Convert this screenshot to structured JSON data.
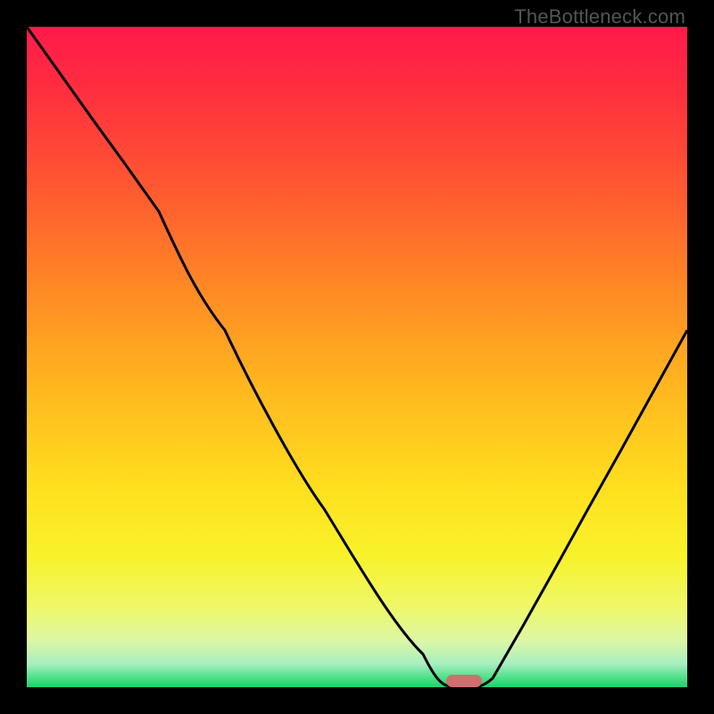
{
  "watermark": "TheBottleneck.com",
  "colors": {
    "bg_black": "#000000",
    "marker": "#cf6f6f",
    "curve_stroke": "#000000",
    "gradient_stops": [
      {
        "offset": 0.0,
        "color": "#ff1a4a"
      },
      {
        "offset": 0.1,
        "color": "#ff2f3f"
      },
      {
        "offset": 0.25,
        "color": "#ff5a30"
      },
      {
        "offset": 0.4,
        "color": "#ff8a25"
      },
      {
        "offset": 0.55,
        "color": "#ffb81f"
      },
      {
        "offset": 0.7,
        "color": "#ffe01f"
      },
      {
        "offset": 0.8,
        "color": "#f8f22a"
      },
      {
        "offset": 0.88,
        "color": "#eef86a"
      },
      {
        "offset": 0.93,
        "color": "#dcf7a6"
      },
      {
        "offset": 0.965,
        "color": "#a7efc0"
      },
      {
        "offset": 0.985,
        "color": "#4fe08a"
      },
      {
        "offset": 1.0,
        "color": "#1fd06b"
      }
    ]
  },
  "chart_data": {
    "type": "line",
    "title": "",
    "xlabel": "",
    "ylabel": "",
    "xlim": [
      0,
      100
    ],
    "ylim": [
      0,
      100
    ],
    "x": [
      0,
      5,
      10,
      15,
      20,
      25,
      30,
      35,
      40,
      45,
      50,
      55,
      60,
      62,
      65,
      68,
      70,
      75,
      80,
      85,
      90,
      95,
      100
    ],
    "values": [
      100,
      93,
      86,
      79,
      72,
      63,
      54,
      45,
      37,
      29,
      21,
      13,
      5,
      1,
      0,
      0,
      1,
      9,
      18,
      27,
      36,
      45,
      54
    ],
    "marker": {
      "x": 66,
      "y": 0,
      "width": 5,
      "height": 2
    }
  }
}
